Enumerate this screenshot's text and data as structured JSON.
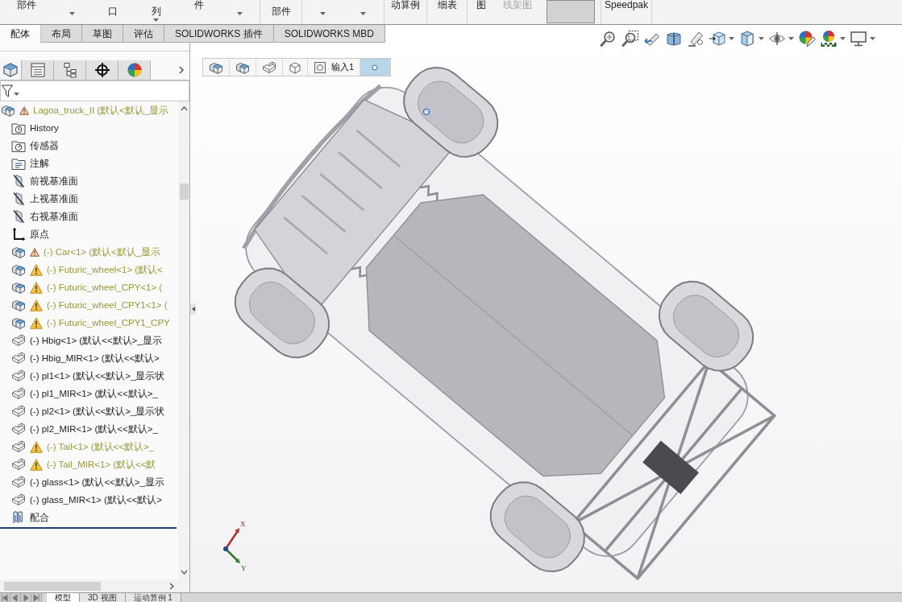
{
  "ribbon": {
    "groups": [
      {
        "buttons": [
          {
            "label": "部件",
            "cut_above": false,
            "caret": false,
            "disabled": false,
            "pressed": false
          },
          {
            "cut_above": true,
            "caret": true,
            "disabled": false,
            "pressed": false
          },
          {
            "label": "口",
            "cut_above": true,
            "caret": false,
            "disabled": false,
            "pressed": false
          },
          {
            "label": "列",
            "cut_above": true,
            "caret": true,
            "disabled": false,
            "pressed": false
          },
          {
            "label": "件",
            "cut_above": false,
            "caret": false,
            "disabled": false,
            "pressed": false
          },
          {
            "cut_above": true,
            "caret": true,
            "disabled": false,
            "pressed": false
          }
        ]
      },
      {
        "buttons": [
          {
            "label": "部件",
            "cut_above": true,
            "caret": false,
            "disabled": false,
            "pressed": false
          }
        ]
      },
      {
        "buttons": [
          {
            "cut_above": true,
            "caret": true,
            "disabled": false,
            "pressed": false
          },
          {
            "cut_above": true,
            "caret": true,
            "disabled": false,
            "pressed": false
          }
        ]
      },
      {
        "buttons": [
          {
            "label": "动算例",
            "cut_above": false,
            "caret": false,
            "disabled": false,
            "pressed": false
          }
        ]
      },
      {
        "buttons": [
          {
            "label": "细表",
            "cut_above": false,
            "caret": false,
            "disabled": false,
            "pressed": false
          }
        ]
      },
      {
        "buttons": [
          {
            "label": "图",
            "cut_above": false,
            "caret": false,
            "disabled": false,
            "pressed": false
          },
          {
            "label": "线架图",
            "cut_above": false,
            "caret": false,
            "disabled": true,
            "pressed": false
          },
          {
            "cut_above": false,
            "caret": false,
            "disabled": false,
            "pressed": true
          }
        ]
      },
      {
        "buttons": [
          {
            "label": "Speedpak",
            "cut_above": false,
            "caret": false,
            "disabled": false,
            "pressed": false
          }
        ]
      }
    ]
  },
  "command_tabs": [
    {
      "label": "配体",
      "selected": true
    },
    {
      "label": "布局",
      "selected": false
    },
    {
      "label": "草图",
      "selected": false
    },
    {
      "label": "评估",
      "selected": false
    },
    {
      "label": "SOLIDWORKS 插件",
      "selected": false
    },
    {
      "label": "SOLIDWORKS MBD",
      "selected": false
    }
  ],
  "feature_tree": {
    "tabs": [
      {
        "kind": "features",
        "selected": true
      },
      {
        "kind": "properties",
        "selected": false
      },
      {
        "kind": "configurations",
        "selected": false
      },
      {
        "kind": "dimxpert",
        "selected": false
      },
      {
        "kind": "display",
        "selected": false
      }
    ],
    "items": [
      {
        "label": "Lagoa_truck_II (默认<默认_显示",
        "kind": "assembly",
        "warning": false,
        "child_warning": true,
        "children": [
          {
            "label": "History",
            "kind": "history",
            "warning": false,
            "child_warning": false
          },
          {
            "label": "传感器",
            "kind": "sensors",
            "warning": false,
            "child_warning": false
          },
          {
            "label": "注解",
            "kind": "annotations",
            "warning": false,
            "child_warning": false
          },
          {
            "label": "前视基准面",
            "kind": "plane",
            "warning": false,
            "child_warning": false
          },
          {
            "label": "上视基准面",
            "kind": "plane",
            "warning": false,
            "child_warning": false
          },
          {
            "label": "右视基准面",
            "kind": "plane",
            "warning": false,
            "child_warning": false
          },
          {
            "label": "原点",
            "kind": "origin",
            "warning": false,
            "child_warning": false
          },
          {
            "label": "(-) Car<1> (默认<默认_显示",
            "kind": "assembly",
            "warning": false,
            "child_warning": true
          },
          {
            "label": "(-) Futuric_wheel<1> (默认<",
            "kind": "assembly",
            "warning": true,
            "child_warning": false
          },
          {
            "label": "(-) Futuric_wheel_CPY<1> (",
            "kind": "assembly",
            "warning": true,
            "child_warning": false
          },
          {
            "label": "(-) Futuric_wheel_CPY1<1> (",
            "kind": "assembly",
            "warning": true,
            "child_warning": false
          },
          {
            "label": "(-) Futuric_wheel_CPY1_CPY",
            "kind": "assembly",
            "warning": true,
            "child_warning": false
          },
          {
            "label": "(-) Hbig<1> (默认<<默认>_显示",
            "kind": "part",
            "warning": false,
            "child_warning": false
          },
          {
            "label": "(-) Hbig_MIR<1> (默认<<默认>",
            "kind": "part",
            "warning": false,
            "child_warning": false
          },
          {
            "label": "(-) pl1<1> (默认<<默认>_显示状",
            "kind": "part",
            "warning": false,
            "child_warning": false
          },
          {
            "label": "(-) pl1_MIR<1> (默认<<默认>_",
            "kind": "part",
            "warning": false,
            "child_warning": false
          },
          {
            "label": "(-) pl2<1> (默认<<默认>_显示状",
            "kind": "part",
            "warning": false,
            "child_warning": false
          },
          {
            "label": "(-) pl2_MIR<1> (默认<<默认>_",
            "kind": "part",
            "warning": false,
            "child_warning": false
          },
          {
            "label": "(-) Tail<1> (默认<<默认>_",
            "kind": "part",
            "warning": true,
            "child_warning": false
          },
          {
            "label": "(-) Tail_MIR<1> (默认<<默",
            "kind": "part",
            "warning": true,
            "child_warning": false
          },
          {
            "label": "(-) glass<1> (默认<<默认>_显示",
            "kind": "part",
            "warning": false,
            "child_warning": false
          },
          {
            "label": "(-) glass_MIR<1> (默认<<默认>",
            "kind": "part",
            "warning": false,
            "child_warning": false
          },
          {
            "label": "配合",
            "kind": "mates",
            "warning": false,
            "child_warning": false
          }
        ]
      }
    ]
  },
  "viewport": {
    "breadcrumb": [
      {
        "kind": "assembly",
        "selected": false
      },
      {
        "kind": "assembly",
        "selected": false
      },
      {
        "kind": "part",
        "selected": false
      },
      {
        "kind": "body",
        "selected": false
      },
      {
        "kind": "feature",
        "label": "输入1",
        "selected": false
      },
      {
        "kind": "point",
        "selected": true
      }
    ],
    "triad": {
      "x_label": "X",
      "y_label": "Y"
    }
  },
  "bottom_tabs": [
    {
      "label": "模型",
      "selected": true
    },
    {
      "label": "3D 视图",
      "selected": false
    },
    {
      "label": "运动算例 1",
      "selected": false
    }
  ]
}
